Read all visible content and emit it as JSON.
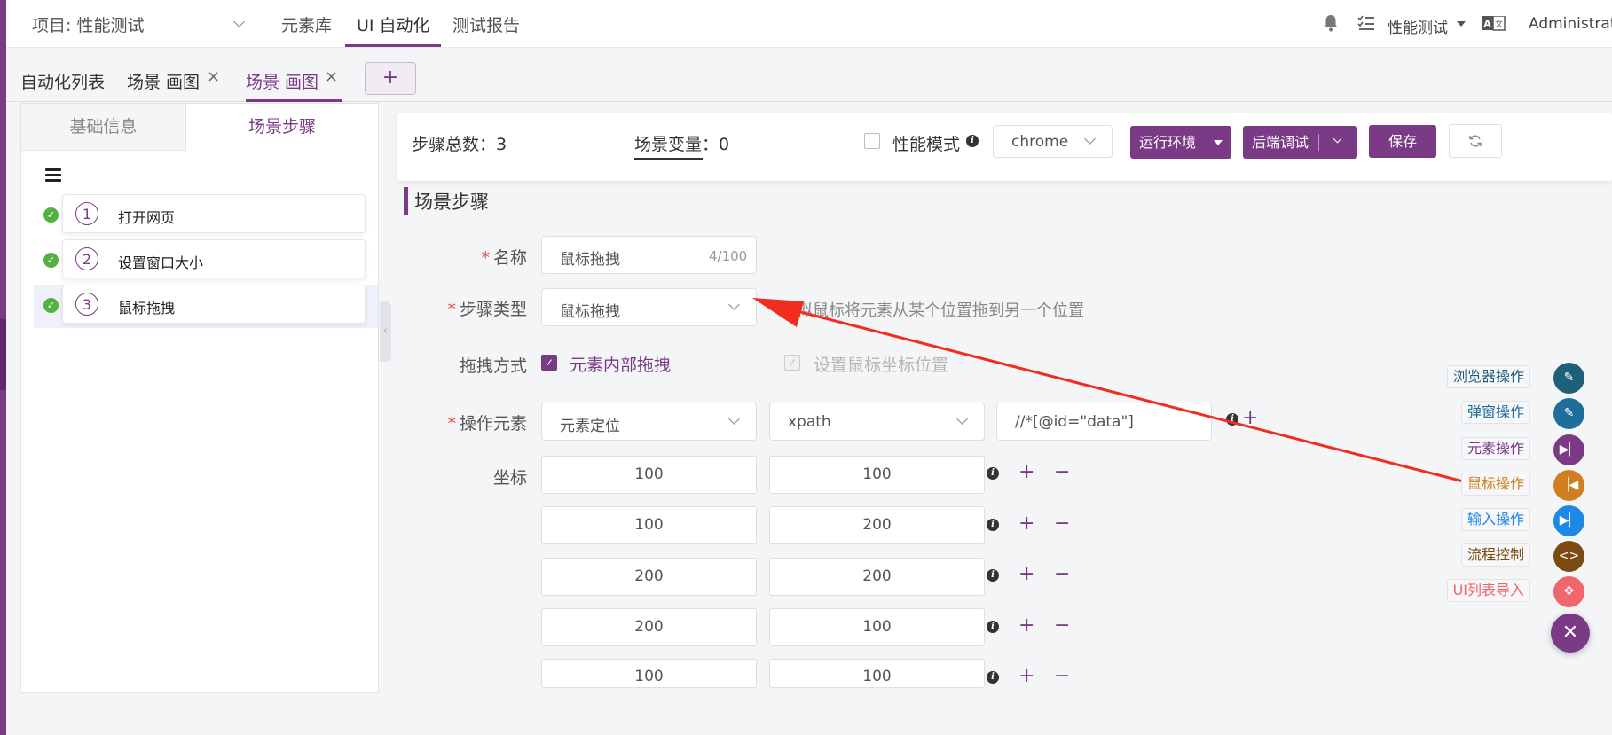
{
  "topbar": {
    "project": "项目: 性能测试",
    "nav": [
      "元素库",
      "UI 自动化",
      "测试报告"
    ],
    "right_project": "性能测试",
    "user": "Administrator"
  },
  "tabs": {
    "list_label": "自动化列表",
    "tab1": "场景 画图",
    "tab2": "场景 画图",
    "close": "×",
    "add": "+"
  },
  "left_panel": {
    "tab_basic": "基础信息",
    "tab_steps": "场景步骤",
    "steps": [
      {
        "num": "1",
        "label": "打开网页"
      },
      {
        "num": "2",
        "label": "设置窗口大小"
      },
      {
        "num": "3",
        "label": "鼠标拖拽"
      }
    ]
  },
  "toolbar": {
    "step_total": "步骤总数：3",
    "scene_var": "场景变量：0",
    "perf_mode": "性能模式",
    "browser": "chrome",
    "run_env": "运行环境",
    "backend_debug": "后端调试",
    "save": "保存"
  },
  "section": {
    "title": "场景步骤"
  },
  "form": {
    "name_label": "名称",
    "name_value": "鼠标拖拽",
    "name_count": "4/100",
    "type_label": "步骤类型",
    "type_value": "鼠标拖拽",
    "type_hint": "模拟鼠标将元素从某个位置拖到另一个位置",
    "drag_label": "拖拽方式",
    "drag_inner": "元素内部拖拽",
    "drag_coord": "设置鼠标坐标位置",
    "element_label": "操作元素",
    "locate_mode": "元素定位",
    "locate_type": "xpath",
    "locator": "//*[@id=\"data\"]",
    "coord_label": "坐标",
    "coords": [
      [
        "100",
        "100"
      ],
      [
        "100",
        "200"
      ],
      [
        "200",
        "200"
      ],
      [
        "200",
        "100"
      ],
      [
        "100",
        "100"
      ]
    ]
  },
  "floating_actions": [
    {
      "label": "浏览器操作",
      "color": "#1e5f7a",
      "icon": "pencil-icon"
    },
    {
      "label": "弹窗操作",
      "color": "#1e6d9a",
      "icon": "pencil-icon"
    },
    {
      "label": "元素操作",
      "color": "#7a3a86",
      "icon": "skip-forward-icon"
    },
    {
      "label": "鼠标操作",
      "color": "#cf7f1f",
      "icon": "skip-back-icon"
    },
    {
      "label": "输入操作",
      "color": "#1d88e5",
      "icon": "skip-forward-icon"
    },
    {
      "label": "流程控制",
      "color": "#7a4a12",
      "icon": "code-icon"
    },
    {
      "label": "UI列表导入",
      "color": "#f1656c",
      "icon": "import-icon"
    }
  ],
  "colors": {
    "primary": "#7a3a86",
    "success": "#53b13f",
    "arrow": "#f12d1f"
  }
}
